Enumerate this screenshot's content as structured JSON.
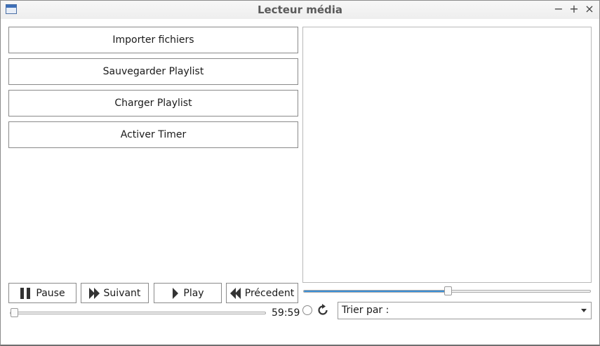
{
  "window": {
    "title": "Lecteur média",
    "controls": {
      "minimize": "−",
      "maximize": "+",
      "close": "×"
    }
  },
  "actions": {
    "import_label": "Importer fichiers",
    "save_playlist_label": "Sauvegarder Playlist",
    "load_playlist_label": "Charger Playlist",
    "timer_label": "Activer Timer"
  },
  "transport": {
    "pause_label": "Pause",
    "next_label": "Suivant",
    "play_label": "Play",
    "previous_label": "Précedent"
  },
  "playback": {
    "time_remaining": "59:59",
    "position_fraction": 0.0,
    "volume_fraction": 0.5
  },
  "playlist": {
    "sort_label": "Trier par :"
  },
  "colors": {
    "accent": "#3a8fd6"
  }
}
